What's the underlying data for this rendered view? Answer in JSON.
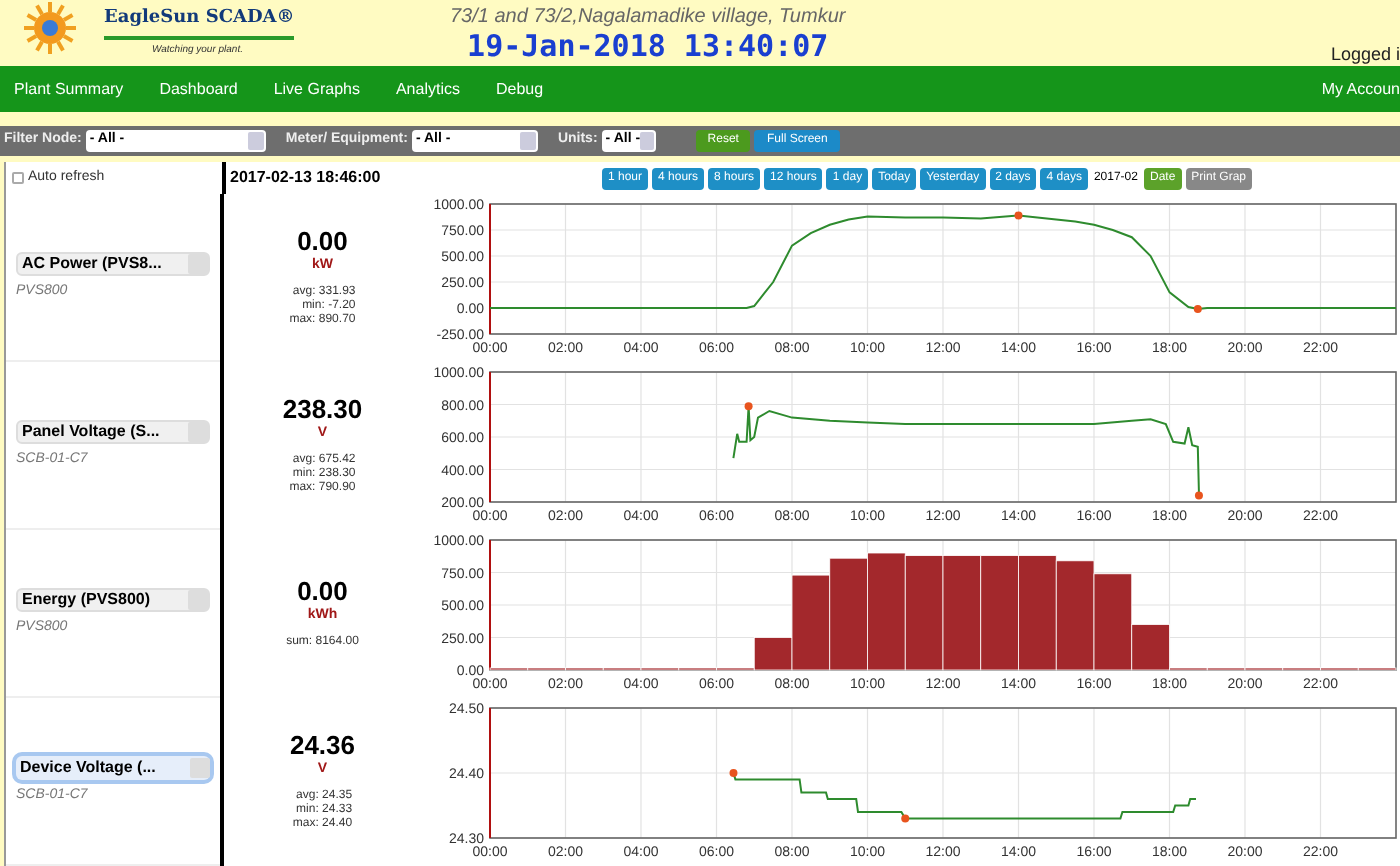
{
  "header": {
    "brand": "EagleSun SCADA®",
    "tagline": "Watching your plant.",
    "address": "73/1 and 73/2,Nagalamadike village, Tumkur",
    "datetime": "19-Jan-2018 13:40:07",
    "user_label": "Logged i"
  },
  "nav": {
    "items": [
      {
        "label": "Plant Summary"
      },
      {
        "label": "Dashboard"
      },
      {
        "label": "Live Graphs"
      },
      {
        "label": "Analytics"
      },
      {
        "label": "Debug"
      }
    ],
    "account": "My Accoun"
  },
  "filters": [
    {
      "label": "Filter Node:",
      "value": "- All -"
    },
    {
      "label": "Meter/ Equipment:",
      "value": "- All -"
    },
    {
      "label": "Units:",
      "value": "- All -"
    }
  ],
  "filter_buttons": [
    {
      "label": "Reset",
      "kind": "reset"
    },
    {
      "label": "Full Screen",
      "kind": "fullscreen"
    }
  ],
  "toolbar": {
    "auto_refresh": {
      "label": "Auto refresh",
      "checked": false
    },
    "timestamp": "2017-02-13 18:46:00",
    "range_buttons": [
      {
        "label": "1 hour"
      },
      {
        "label": "4 hours"
      },
      {
        "label": "8 hours"
      },
      {
        "label": "12 hours"
      },
      {
        "label": "1 day"
      },
      {
        "label": "Today"
      },
      {
        "label": "Yesterday"
      },
      {
        "label": "2 days"
      },
      {
        "label": "4 days"
      }
    ],
    "date_value": "2017-02",
    "date_button": "Date",
    "print_button": "Print Grap"
  },
  "channels": [
    {
      "name": "AC Power (PVS8...",
      "device": "PVS800",
      "selected": false,
      "value": "0.00",
      "unit": "kW",
      "stats": [
        "avg: 331.93",
        "min: -7.20",
        "max: 890.70"
      ],
      "chart_data": {
        "type": "line",
        "grid": true,
        "x": [
          0,
          6.8,
          7,
          7.5,
          8,
          8.5,
          9,
          9.5,
          10,
          11,
          12,
          13,
          14,
          15,
          15.5,
          16,
          16.5,
          17,
          17.5,
          18,
          18.5,
          18.75,
          19,
          24
        ],
        "series": [
          {
            "color": "#2e8b2e",
            "values": [
              0,
              0,
              20,
              250,
              600,
              720,
              800,
              850,
              880,
              870,
              870,
              860,
              890,
              850,
              830,
              800,
              750,
              680,
              500,
              150,
              10,
              -10,
              0,
              0
            ]
          }
        ],
        "xlim": [
          0,
          24
        ],
        "ylim": [
          -250,
          1000
        ],
        "xticks": [
          {
            "value": 0,
            "label": "00:00"
          },
          {
            "value": 2,
            "label": "02:00"
          },
          {
            "value": 4,
            "label": "04:00"
          },
          {
            "value": 6,
            "label": "06:00"
          },
          {
            "value": 8,
            "label": "08:00"
          },
          {
            "value": 10,
            "label": "10:00"
          },
          {
            "value": 12,
            "label": "12:00"
          },
          {
            "value": 14,
            "label": "14:00"
          },
          {
            "value": 16,
            "label": "16:00"
          },
          {
            "value": 18,
            "label": "18:00"
          },
          {
            "value": 20,
            "label": "20:00"
          },
          {
            "value": 22,
            "label": "22:00"
          }
        ],
        "yticks": [
          {
            "value": -250,
            "label": "-250.00"
          },
          {
            "value": 0,
            "label": "0.00"
          },
          {
            "value": 250,
            "label": "250.00"
          },
          {
            "value": 500,
            "label": "500.00"
          },
          {
            "value": 750,
            "label": "750.00"
          },
          {
            "value": 1000,
            "label": "1000.00"
          }
        ]
      }
    },
    {
      "name": "Panel Voltage (S...",
      "device": "SCB-01-C7",
      "selected": false,
      "value": "238.30",
      "unit": "V",
      "stats": [
        "avg: 675.42",
        "min: 238.30",
        "max: 790.90"
      ],
      "chart_data": {
        "type": "line",
        "grid": true,
        "x": [
          6.45,
          6.55,
          6.6,
          6.8,
          6.85,
          6.9,
          7,
          7.1,
          7.4,
          8,
          9,
          10,
          11,
          12,
          13,
          14,
          15,
          16,
          17,
          17.5,
          17.9,
          18.1,
          18.4,
          18.5,
          18.6,
          18.75,
          18.78
        ],
        "series": [
          {
            "color": "#2e8b2e",
            "values": [
              470,
              620,
              570,
              570,
              790,
              580,
              600,
              720,
              760,
              720,
              700,
              690,
              680,
              680,
              680,
              680,
              680,
              680,
              700,
              710,
              680,
              570,
              560,
              660,
              550,
              540,
              240
            ]
          }
        ],
        "xlim": [
          0,
          24
        ],
        "ylim": [
          200,
          1000
        ],
        "xticks": [
          {
            "value": 0,
            "label": "00:00"
          },
          {
            "value": 2,
            "label": "02:00"
          },
          {
            "value": 4,
            "label": "04:00"
          },
          {
            "value": 6,
            "label": "06:00"
          },
          {
            "value": 8,
            "label": "08:00"
          },
          {
            "value": 10,
            "label": "10:00"
          },
          {
            "value": 12,
            "label": "12:00"
          },
          {
            "value": 14,
            "label": "14:00"
          },
          {
            "value": 16,
            "label": "16:00"
          },
          {
            "value": 18,
            "label": "18:00"
          },
          {
            "value": 20,
            "label": "20:00"
          },
          {
            "value": 22,
            "label": "22:00"
          }
        ],
        "yticks": [
          {
            "value": 200,
            "label": "200.00"
          },
          {
            "value": 400,
            "label": "400.00"
          },
          {
            "value": 600,
            "label": "600.00"
          },
          {
            "value": 800,
            "label": "800.00"
          },
          {
            "value": 1000,
            "label": "1000.00"
          }
        ]
      }
    },
    {
      "name": "Energy (PVS800)",
      "device": "PVS800",
      "selected": false,
      "value": "0.00",
      "unit": "kWh",
      "stats": [
        "sum: 8164.00"
      ],
      "chart_data": {
        "type": "bar",
        "grid": true,
        "x": [
          0.5,
          1.5,
          2.5,
          3.5,
          4.5,
          5.5,
          6.5,
          7.5,
          8.5,
          9.5,
          10.5,
          11.5,
          12.5,
          13.5,
          14.5,
          15.5,
          16.5,
          17.5,
          18.5,
          19.5,
          20.5,
          21.5,
          22.5,
          23.5
        ],
        "series": [
          {
            "color": "#a3282c",
            "values": [
              0,
              0,
              0,
              0,
              0,
              0,
              0,
              250,
              730,
              860,
              900,
              880,
              880,
              880,
              880,
              840,
              740,
              350,
              0,
              0,
              0,
              0,
              0,
              0
            ]
          }
        ],
        "xlim": [
          0,
          24
        ],
        "ylim": [
          0,
          1000
        ],
        "xticks": [
          {
            "value": 0,
            "label": "00:00"
          },
          {
            "value": 2,
            "label": "02:00"
          },
          {
            "value": 4,
            "label": "04:00"
          },
          {
            "value": 6,
            "label": "06:00"
          },
          {
            "value": 8,
            "label": "08:00"
          },
          {
            "value": 10,
            "label": "10:00"
          },
          {
            "value": 12,
            "label": "12:00"
          },
          {
            "value": 14,
            "label": "14:00"
          },
          {
            "value": 16,
            "label": "16:00"
          },
          {
            "value": 18,
            "label": "18:00"
          },
          {
            "value": 20,
            "label": "20:00"
          },
          {
            "value": 22,
            "label": "22:00"
          }
        ],
        "yticks": [
          {
            "value": 0,
            "label": "0.00"
          },
          {
            "value": 250,
            "label": "250.00"
          },
          {
            "value": 500,
            "label": "500.00"
          },
          {
            "value": 750,
            "label": "750.00"
          },
          {
            "value": 1000,
            "label": "1000.00"
          }
        ]
      }
    },
    {
      "name": "Device Voltage (...",
      "device": "SCB-01-C7",
      "selected": true,
      "value": "24.36",
      "unit": "V",
      "stats": [
        "avg: 24.35",
        "min: 24.33",
        "max: 24.40"
      ],
      "chart_data": {
        "type": "line",
        "grid": true,
        "x": [
          6.45,
          6.5,
          8.2,
          8.25,
          8.9,
          8.95,
          9.7,
          9.75,
          10.9,
          11,
          16.7,
          16.75,
          18.1,
          18.15,
          18.5,
          18.55,
          18.7
        ],
        "series": [
          {
            "color": "#2e8b2e",
            "values": [
              24.4,
              24.39,
              24.39,
              24.37,
              24.37,
              24.36,
              24.36,
              24.34,
              24.34,
              24.33,
              24.33,
              24.34,
              24.34,
              24.35,
              24.35,
              24.36,
              24.36
            ]
          }
        ],
        "xlim": [
          0,
          24
        ],
        "ylim": [
          24.3,
          24.5
        ],
        "xticks": [
          {
            "value": 0,
            "label": "00:00"
          },
          {
            "value": 2,
            "label": "02:00"
          },
          {
            "value": 4,
            "label": "04:00"
          },
          {
            "value": 6,
            "label": "06:00"
          },
          {
            "value": 8,
            "label": "08:00"
          },
          {
            "value": 10,
            "label": "10:00"
          },
          {
            "value": 12,
            "label": "12:00"
          },
          {
            "value": 14,
            "label": "14:00"
          },
          {
            "value": 16,
            "label": "16:00"
          },
          {
            "value": 18,
            "label": "18:00"
          },
          {
            "value": 20,
            "label": "20:00"
          },
          {
            "value": 22,
            "label": "22:00"
          }
        ],
        "yticks": [
          {
            "value": 24.3,
            "label": "24.30"
          },
          {
            "value": 24.4,
            "label": "24.40"
          },
          {
            "value": 24.5,
            "label": "24.50"
          }
        ]
      }
    }
  ]
}
